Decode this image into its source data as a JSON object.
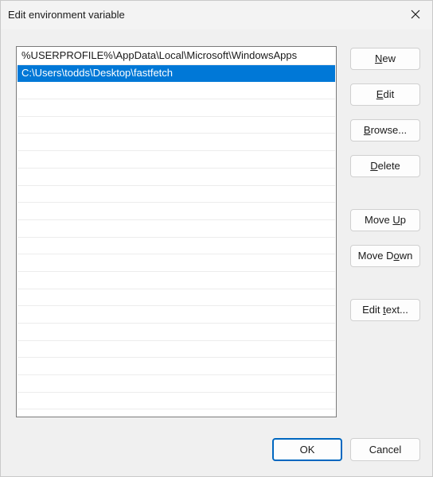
{
  "window": {
    "title": "Edit environment variable"
  },
  "list": {
    "items": [
      "%USERPROFILE%\\AppData\\Local\\Microsoft\\WindowsApps",
      "C:\\Users\\todds\\Desktop\\fastfetch"
    ],
    "selected_index": 1
  },
  "buttons": {
    "new": {
      "pre": "",
      "mn": "N",
      "post": "ew"
    },
    "edit": {
      "pre": "",
      "mn": "E",
      "post": "dit"
    },
    "browse": {
      "pre": "",
      "mn": "B",
      "post": "rowse..."
    },
    "delete": {
      "pre": "",
      "mn": "D",
      "post": "elete"
    },
    "move_up": {
      "pre": "Move ",
      "mn": "U",
      "post": "p"
    },
    "move_down": {
      "pre": "Move D",
      "mn": "o",
      "post": "wn"
    },
    "edit_text": {
      "pre": "Edit ",
      "mn": "t",
      "post": "ext..."
    },
    "ok": "OK",
    "cancel": "Cancel"
  },
  "colors": {
    "selection": "#0078d7",
    "ok_border": "#0067c0"
  }
}
